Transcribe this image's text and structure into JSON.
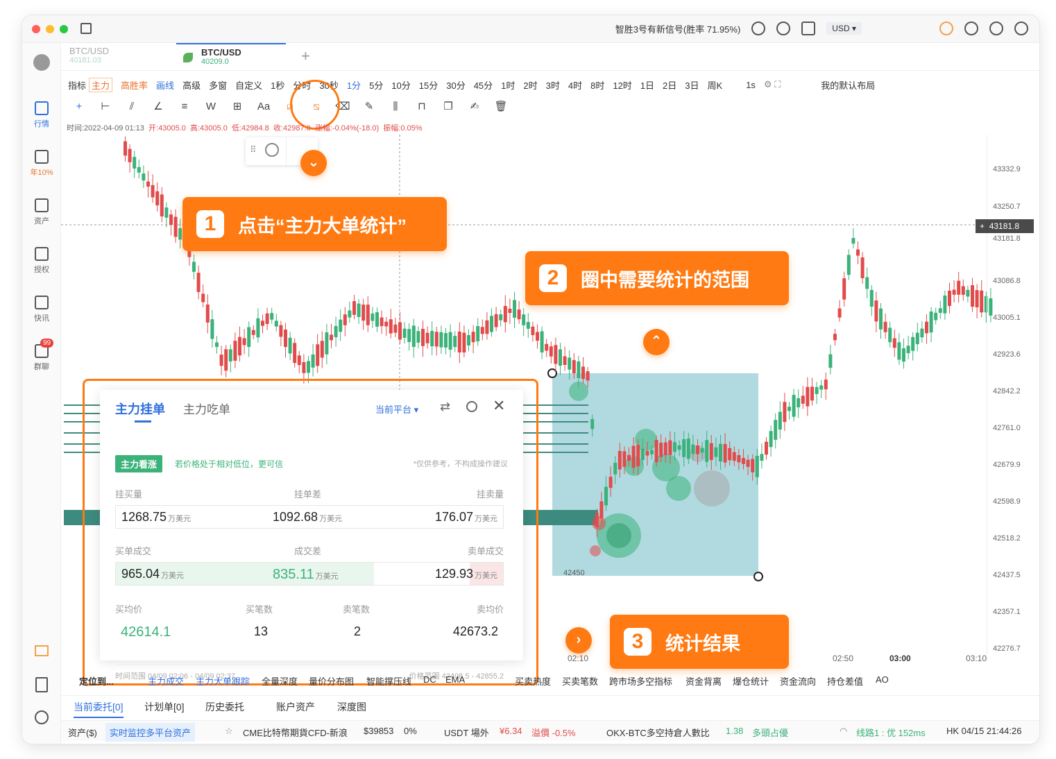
{
  "window": {
    "notification": "智胜3号有新信号(胜率 71.95%)",
    "currency": "USD"
  },
  "sidebar": {
    "items": [
      {
        "label": "行情"
      },
      {
        "label": "年10%"
      },
      {
        "label": "资产"
      },
      {
        "label": "授权"
      },
      {
        "label": "快讯"
      },
      {
        "label": "群聊",
        "badge": "99"
      }
    ]
  },
  "tabs": [
    {
      "name": "BTC/USD",
      "price": "40181.03"
    },
    {
      "name": "BTC/USD",
      "price": "40209.0"
    }
  ],
  "toolbar": {
    "items": [
      "指标",
      "主力",
      "高胜率",
      "画线",
      "高级",
      "多窗",
      "自定义",
      "1秒",
      "分时",
      "30秒",
      "1分",
      "5分",
      "10分",
      "15分",
      "30分",
      "45分",
      "1时",
      "2时",
      "3时",
      "4时",
      "8时",
      "12时",
      "1日",
      "2日",
      "3日",
      "周K"
    ],
    "interval": "1s",
    "layout": "我的默认布局"
  },
  "ohlc": {
    "time": "时间:2022-04-09 01:13",
    "open": "开:43005.0",
    "high": "高:43005.0",
    "low": "低:42984.8",
    "close": "收:42987.0",
    "change": "涨幅:-0.04%(-18.0)",
    "amplitude": "振幅:0.05%"
  },
  "price_axis": [
    "43332.9",
    "43250.7",
    "43181.8",
    "43086.8",
    "43005.1",
    "42923.6",
    "42842.2",
    "42761.0",
    "42679.9",
    "42598.9",
    "42518.2",
    "42437.5",
    "42357.1",
    "42276.7"
  ],
  "time_axis": [
    "02:10",
    "02:50",
    "03:00",
    "03:10"
  ],
  "chart": {
    "current_price": "43181.8",
    "range_low_label": "42450"
  },
  "callouts": {
    "step1": {
      "num": "1",
      "text": "点击“主力大单统计”"
    },
    "step2": {
      "num": "2",
      "text": "圈中需要统计的范围"
    },
    "step3": {
      "num": "3",
      "text": "统计结果"
    }
  },
  "panel": {
    "tab_active": "主力挂单",
    "tab_other": "主力吃单",
    "platform": "当前平台",
    "signal_badge": "主力看涨",
    "signal_note": "若价格处于相对低位，更可信",
    "disclaimer": "*仅供参考，不构成操作建议",
    "row1_labels": {
      "a": "挂买量",
      "b": "挂单差",
      "c": "挂卖量"
    },
    "row1_values": {
      "a": "1268.75",
      "b": "1092.68",
      "c": "176.07"
    },
    "row2_labels": {
      "a": "买单成交",
      "b": "成交差",
      "c": "卖单成交"
    },
    "row2_values": {
      "a": "965.04",
      "b": "835.11",
      "c": "129.93"
    },
    "unit": "万美元",
    "row3_labels": {
      "a": "买均价",
      "b": "买笔数",
      "c": "卖笔数",
      "d": "卖均价"
    },
    "row3_values": {
      "a": "42614.1",
      "b": "13",
      "c": "2",
      "d": "42673.2"
    },
    "time_range": "时间范围  04/09 02:06 - 04/09 02:37",
    "price_range": "价格范围  42408.5 - 42855.2"
  },
  "bottom_bar": [
    "定位到...",
    "主力成交",
    "主力大单跟踪",
    "全量深度",
    "量价分布图",
    "智能撑压线",
    "DC",
    "EMA",
    "买卖热度",
    "买卖笔数",
    "跨市场多空指标",
    "资金背离",
    "爆仓统计",
    "资金流向",
    "持仓差值",
    "AO"
  ],
  "order_tabs": [
    "当前委托[0]",
    "计划单[0]",
    "历史委托",
    "账户资产",
    "深度图"
  ],
  "status_bar": {
    "asset": "资产($)",
    "monitor": "实时监控多平台资产",
    "ticker1": "CME比特幣期貨CFD-新浪",
    "ticker1_price": "$39853",
    "ticker1_change": "0%",
    "ticker2": "USDT 場外",
    "ticker2_price": "¥6.34",
    "ticker2_premium": "溢價 -0.5%",
    "ticker3": "OKX-BTC多空持倉人數比",
    "ticker3_value": "1.38",
    "ticker3_note": "多頭占優",
    "line": "线路1 : 优 152ms",
    "clock": "HK 04/15 21:44:26"
  },
  "colors": {
    "accent": "#ff7a12",
    "up": "#3bb27a",
    "down": "#e24b4b",
    "brand_blue": "#2f6fde",
    "selection": "#87c6cf"
  }
}
